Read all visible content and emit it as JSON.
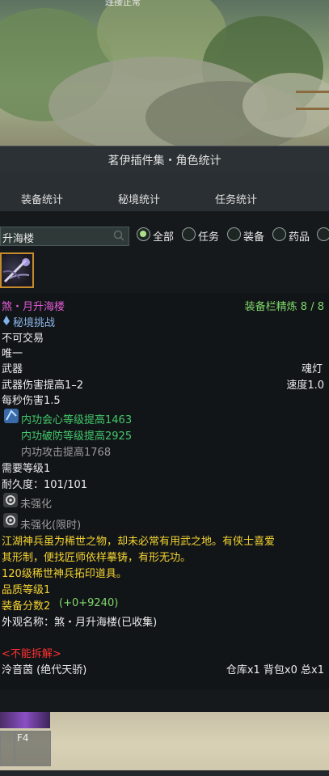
{
  "status": {
    "connection": "连接正常"
  },
  "panel": {
    "title": "茗伊插件集・角色统计",
    "tabs": [
      "装备统计",
      "秘境统计",
      "任务统计"
    ]
  },
  "search": {
    "value": "升海楼"
  },
  "filters": [
    {
      "label": "全部",
      "selected": true
    },
    {
      "label": "任务",
      "selected": false
    },
    {
      "label": "装备",
      "selected": false
    },
    {
      "label": "药品",
      "selected": false
    }
  ],
  "tooltip": {
    "item_name": "煞・月升海楼",
    "refine": "装备栏精炼 8 / 8",
    "source": "秘境挑战",
    "no_trade": "不可交易",
    "unique": "唯一",
    "category": "武器",
    "sub_type": "魂灯",
    "damage": "武器伤害提高1–2",
    "speed": "速度1.0",
    "dps": "每秒伤害1.5",
    "attr1": "内功会心等级提高1463",
    "attr2": "内功破防等级提高2925",
    "attr3": "内功攻击提高1768",
    "req_level": "需要等级1",
    "durability": "耐久度：101/101",
    "enhance1": "未强化",
    "enhance2": "未强化(限时)",
    "lore": [
      "江湖神兵虽为稀世之物，却未必常有用武之地。有侠士喜爱",
      "其形制，便找匠师依样摹铸，有形无功。"
    ],
    "tier": "120级稀世神兵拓印道具。",
    "quality": "品质等级1",
    "score_label": "装备分数2",
    "score_extra": "(+0+9240)",
    "appearance": "外观名称：煞・月升海楼(已收集)",
    "no_dismantle": "<不能拆解>",
    "owner": "泠音茵 (绝代天骄)",
    "counts": "仓库x1 背包x0 总x1"
  },
  "hotbar": {
    "key": "F4"
  }
}
